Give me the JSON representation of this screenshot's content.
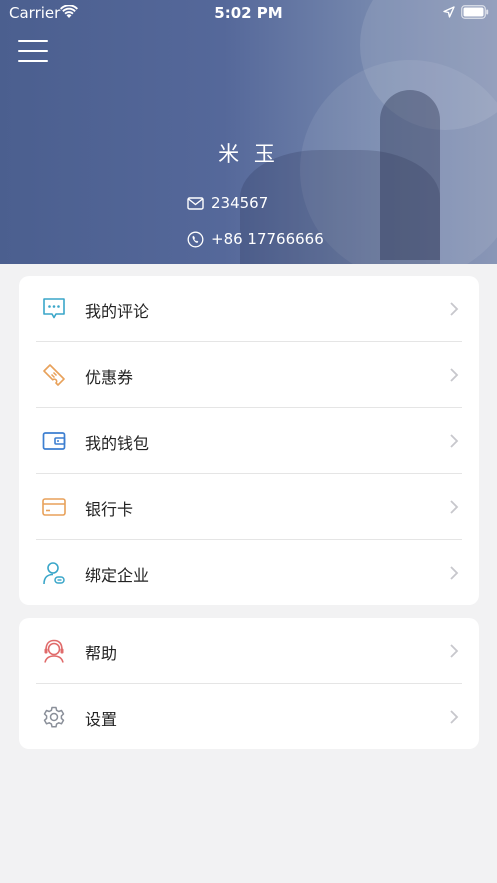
{
  "status_bar": {
    "carrier": "Carrier",
    "time": "5:02 PM"
  },
  "profile": {
    "name": "米 玉",
    "email": "234567",
    "phone": "+86 17766666"
  },
  "menu_group_1": [
    {
      "label": "我的评论",
      "icon": "comment-icon",
      "color": "#3aa6c9"
    },
    {
      "label": "优惠券",
      "icon": "coupon-icon",
      "color": "#e8a15a"
    },
    {
      "label": "我的钱包",
      "icon": "wallet-icon",
      "color": "#3d7fd1"
    },
    {
      "label": "银行卡",
      "icon": "bank-card-icon",
      "color": "#e8a15a"
    },
    {
      "label": "绑定企业",
      "icon": "bind-company-icon",
      "color": "#3aa6c9"
    }
  ],
  "menu_group_2": [
    {
      "label": "帮助",
      "icon": "help-icon",
      "color": "#e06b6b"
    },
    {
      "label": "设置",
      "icon": "settings-icon",
      "color": "#8a8f99"
    }
  ],
  "colors": {
    "header_bg": "#4b5f8f",
    "page_bg": "#f2f2f3",
    "card_bg": "#ffffff",
    "chevron": "#c7c7cc"
  }
}
